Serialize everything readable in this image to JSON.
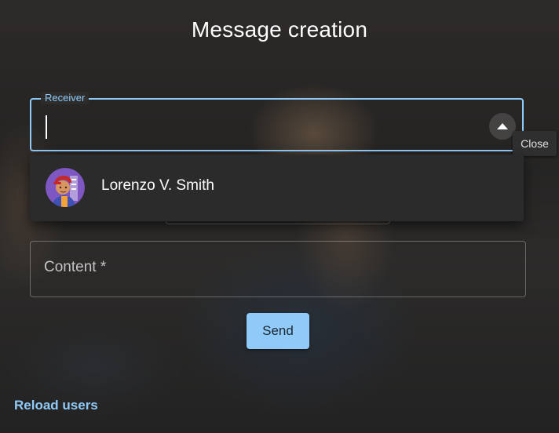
{
  "dialog": {
    "title": "Message creation"
  },
  "receiver": {
    "label": "Receiver",
    "value": "",
    "toggle_icon": "chevron-up-icon",
    "tooltip": "Close"
  },
  "options": [
    {
      "name": "Lorenzo V. Smith",
      "avatar_icon": "avatar-illustration"
    }
  ],
  "content": {
    "placeholder": "Content *"
  },
  "actions": {
    "send_label": "Send",
    "reload_label": "Reload users"
  },
  "colors": {
    "accent": "#90caf9",
    "panel": "#2b2b2b"
  }
}
